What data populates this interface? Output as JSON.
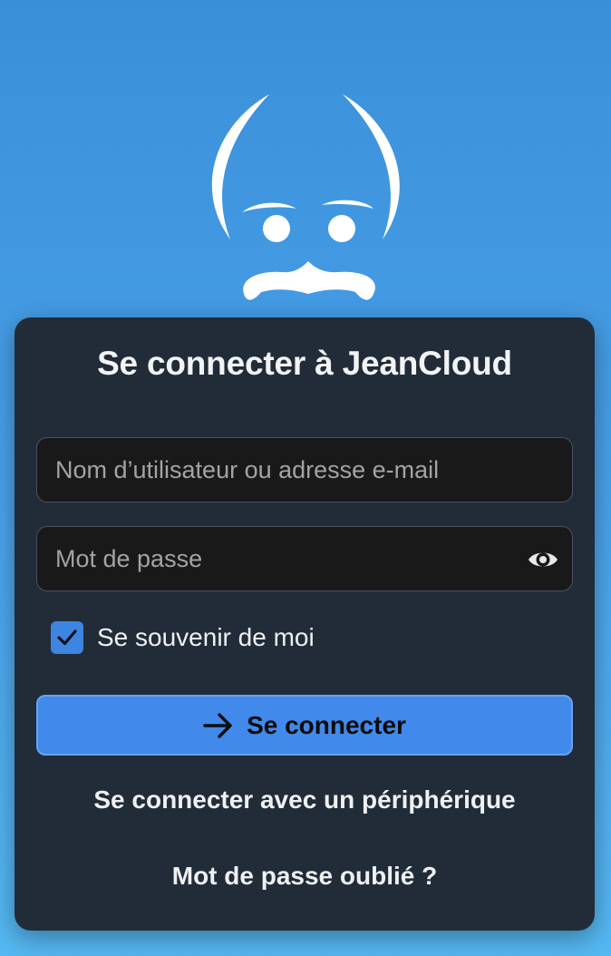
{
  "logo": {
    "icon": "jeancloud-face-logo"
  },
  "login": {
    "title": "Se connecter à JeanCloud",
    "username": {
      "placeholder": "Nom d’utilisateur ou adresse e-mail",
      "value": ""
    },
    "password": {
      "placeholder": "Mot de passe",
      "value": "",
      "toggle_icon": "eye-icon"
    },
    "remember": {
      "label": "Se souvenir de moi",
      "checked": true
    },
    "submit": {
      "label": "Se connecter",
      "icon": "arrow-right-icon"
    },
    "device_link": "Se connecter avec un périphérique",
    "forgot_link": "Mot de passe oublié ?"
  },
  "colors": {
    "background_top": "#3a8fd9",
    "background_bottom": "#55b8f2",
    "card": "#212c38",
    "accent": "#4189ea",
    "input_bg": "#191919"
  }
}
